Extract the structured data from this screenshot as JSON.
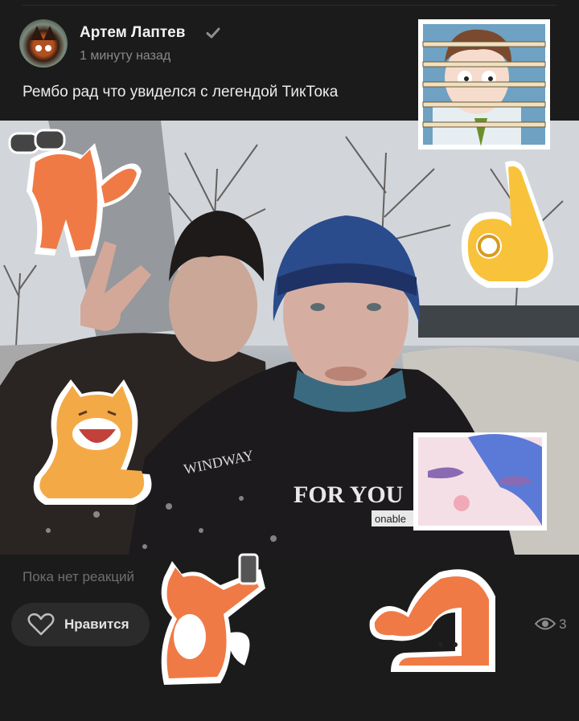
{
  "post": {
    "author": "Артем Лаптев",
    "time": "1 минуту назад",
    "text": "Рембо рад что увиделся с легендой ТикТока"
  },
  "photo": {
    "jacket_text_1": "FOR YOU",
    "jacket_text_2": "onable",
    "jacket_text_3": "WINDWAY"
  },
  "footer": {
    "reactions_text": "Пока нет реакций",
    "like_label": "Нравится",
    "views_count": "3"
  },
  "icons": {
    "verified": "checkmark-icon",
    "like": "heart-outline-icon",
    "views": "eye-icon"
  },
  "colors": {
    "background": "#1b1b1b",
    "button_bg": "#2b2b2b",
    "muted_text": "#8a8a8a"
  }
}
